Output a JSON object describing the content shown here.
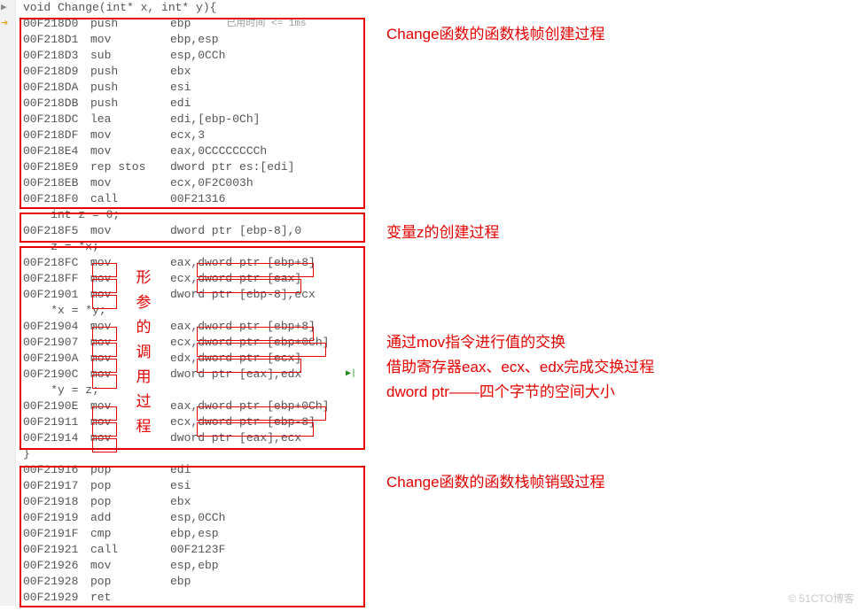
{
  "signature": "void Change(int* x, int* y){",
  "used_time": "已用时间 <= 1ms",
  "lines": [
    {
      "addr": "00F218D0",
      "instr": "push",
      "op": "ebp",
      "bp": true
    },
    {
      "addr": "00F218D1",
      "instr": "mov",
      "op": "ebp,esp"
    },
    {
      "addr": "00F218D3",
      "instr": "sub",
      "op": "esp,0CCh"
    },
    {
      "addr": "00F218D9",
      "instr": "push",
      "op": "ebx"
    },
    {
      "addr": "00F218DA",
      "instr": "push",
      "op": "esi"
    },
    {
      "addr": "00F218DB",
      "instr": "push",
      "op": "edi"
    },
    {
      "addr": "00F218DC",
      "instr": "lea",
      "op": "edi,[ebp-0Ch]"
    },
    {
      "addr": "00F218DF",
      "instr": "mov",
      "op": "ecx,3"
    },
    {
      "addr": "00F218E4",
      "instr": "mov",
      "op": "eax,0CCCCCCCCh"
    },
    {
      "addr": "00F218E9",
      "instr": "rep stos",
      "op": "dword ptr es:[edi]"
    },
    {
      "addr": "00F218EB",
      "instr": "mov",
      "op": "ecx,0F2C003h"
    },
    {
      "addr": "00F218F0",
      "instr": "call",
      "op": "00F21316"
    },
    {
      "src": "    int z = 0;"
    },
    {
      "addr": "00F218F5",
      "instr": "mov",
      "op": "dword ptr [ebp-8],0"
    },
    {
      "src": "    z = *x;"
    },
    {
      "addr": "00F218FC",
      "instr": "mov",
      "op": "eax,dword ptr [ebp+8]"
    },
    {
      "addr": "00F218FF",
      "instr": "mov",
      "op": "ecx,dword ptr [eax]"
    },
    {
      "addr": "00F21901",
      "instr": "mov",
      "op": "dword ptr [ebp-8],ecx"
    },
    {
      "src": "    *x = *y;"
    },
    {
      "addr": "00F21904",
      "instr": "mov",
      "op": "eax,dword ptr [ebp+8]"
    },
    {
      "addr": "00F21907",
      "instr": "mov",
      "op": "ecx,dword ptr [ebp+0Ch]"
    },
    {
      "addr": "00F2190A",
      "instr": "mov",
      "op": "edx,dword ptr [ecx]"
    },
    {
      "addr": "00F2190C",
      "instr": "mov",
      "op": "dword ptr [eax],edx",
      "arrow": true
    },
    {
      "src": "    *y = z;"
    },
    {
      "addr": "00F2190E",
      "instr": "mov",
      "op": "eax,dword ptr [ebp+0Ch]"
    },
    {
      "addr": "00F21911",
      "instr": "mov",
      "op": "ecx,dword ptr [ebp-8]"
    },
    {
      "addr": "00F21914",
      "instr": "mov",
      "op": "dword ptr [eax],ecx"
    },
    {
      "src": "}"
    },
    {
      "addr": "00F21916",
      "instr": "pop",
      "op": "edi"
    },
    {
      "addr": "00F21917",
      "instr": "pop",
      "op": "esi"
    },
    {
      "addr": "00F21918",
      "instr": "pop",
      "op": "ebx"
    },
    {
      "addr": "00F21919",
      "instr": "add",
      "op": "esp,0CCh"
    },
    {
      "addr": "00F2191F",
      "instr": "cmp",
      "op": "ebp,esp"
    },
    {
      "addr": "00F21921",
      "instr": "call",
      "op": "00F2123F"
    },
    {
      "addr": "00F21926",
      "instr": "mov",
      "op": "esp,ebp"
    },
    {
      "addr": "00F21928",
      "instr": "pop",
      "op": "ebp"
    },
    {
      "addr": "00F21929",
      "instr": "ret",
      "op": ""
    }
  ],
  "annotations": {
    "a1": "Change函数的函数栈帧创建过程",
    "a2": "变量z的创建过程",
    "a3_l1": "通过mov指令进行值的交换",
    "a3_l2": "借助寄存器eax、ecx、edx完成交换过程",
    "a3_l3": "dword ptr——四个字节的空间大小",
    "a4": "Change函数的函数栈帧销毁过程",
    "vert": "形参的调用过程"
  },
  "watermark": "© 51CTO博客"
}
